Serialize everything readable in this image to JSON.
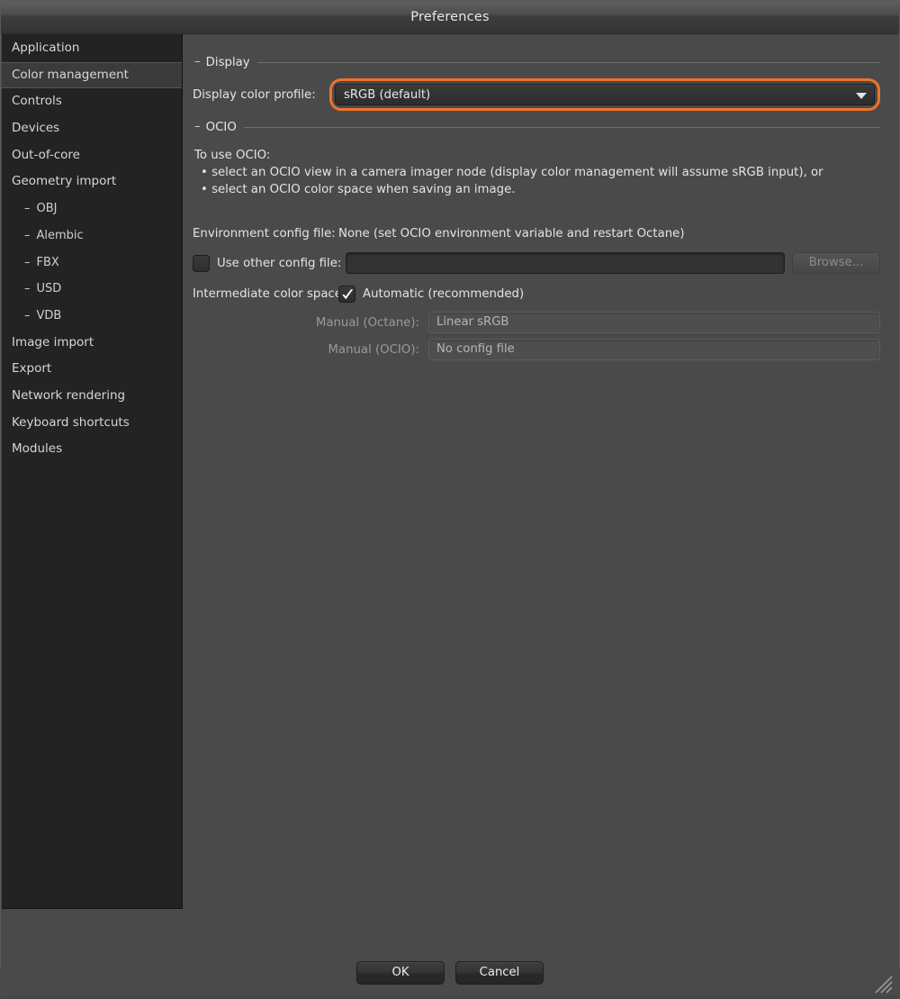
{
  "window": {
    "title": "Preferences"
  },
  "sidebar": {
    "items": [
      {
        "label": "Application",
        "selected": false,
        "sub": false
      },
      {
        "label": "Color management",
        "selected": true,
        "sub": false
      },
      {
        "label": "Controls",
        "selected": false,
        "sub": false
      },
      {
        "label": "Devices",
        "selected": false,
        "sub": false
      },
      {
        "label": "Out-of-core",
        "selected": false,
        "sub": false
      },
      {
        "label": "Geometry import",
        "selected": false,
        "sub": false
      },
      {
        "label": "OBJ",
        "selected": false,
        "sub": true,
        "dash": "–"
      },
      {
        "label": "Alembic",
        "selected": false,
        "sub": true,
        "dash": "–"
      },
      {
        "label": "FBX",
        "selected": false,
        "sub": true,
        "dash": "–"
      },
      {
        "label": "USD",
        "selected": false,
        "sub": true,
        "dash": "–"
      },
      {
        "label": "VDB",
        "selected": false,
        "sub": true,
        "dash": "–"
      },
      {
        "label": "Image import",
        "selected": false,
        "sub": false
      },
      {
        "label": "Export",
        "selected": false,
        "sub": false
      },
      {
        "label": "Network rendering",
        "selected": false,
        "sub": false
      },
      {
        "label": "Keyboard shortcuts",
        "selected": false,
        "sub": false
      },
      {
        "label": "Modules",
        "selected": false,
        "sub": false
      }
    ]
  },
  "display_group": {
    "dash": "–",
    "title": "Display",
    "profile_label": "Display color profile:",
    "profile_value": "sRGB (default)",
    "highlight_color": "#f2712a"
  },
  "ocio_group": {
    "dash": "–",
    "title": "OCIO",
    "intro": "To use OCIO:",
    "bullets": [
      "• select an OCIO view in a camera imager node (display color management will assume sRGB input), or",
      "• select an OCIO color space when saving an image."
    ],
    "env_label": "Environment config file:",
    "env_value": "None (set OCIO environment variable and restart Octane)",
    "use_other_label": "Use other config file:",
    "use_other_checked": false,
    "config_path_value": "",
    "browse_label": "Browse...",
    "browse_disabled": true,
    "intermediate_label": "Intermediate color space:",
    "automatic_label": "Automatic (recommended)",
    "automatic_checked": true,
    "manual_octane_label": "Manual (Octane):",
    "manual_octane_value": "Linear sRGB",
    "manual_ocio_label": "Manual (OCIO):",
    "manual_ocio_value": "No config file"
  },
  "footer": {
    "ok_label": "OK",
    "cancel_label": "Cancel"
  }
}
